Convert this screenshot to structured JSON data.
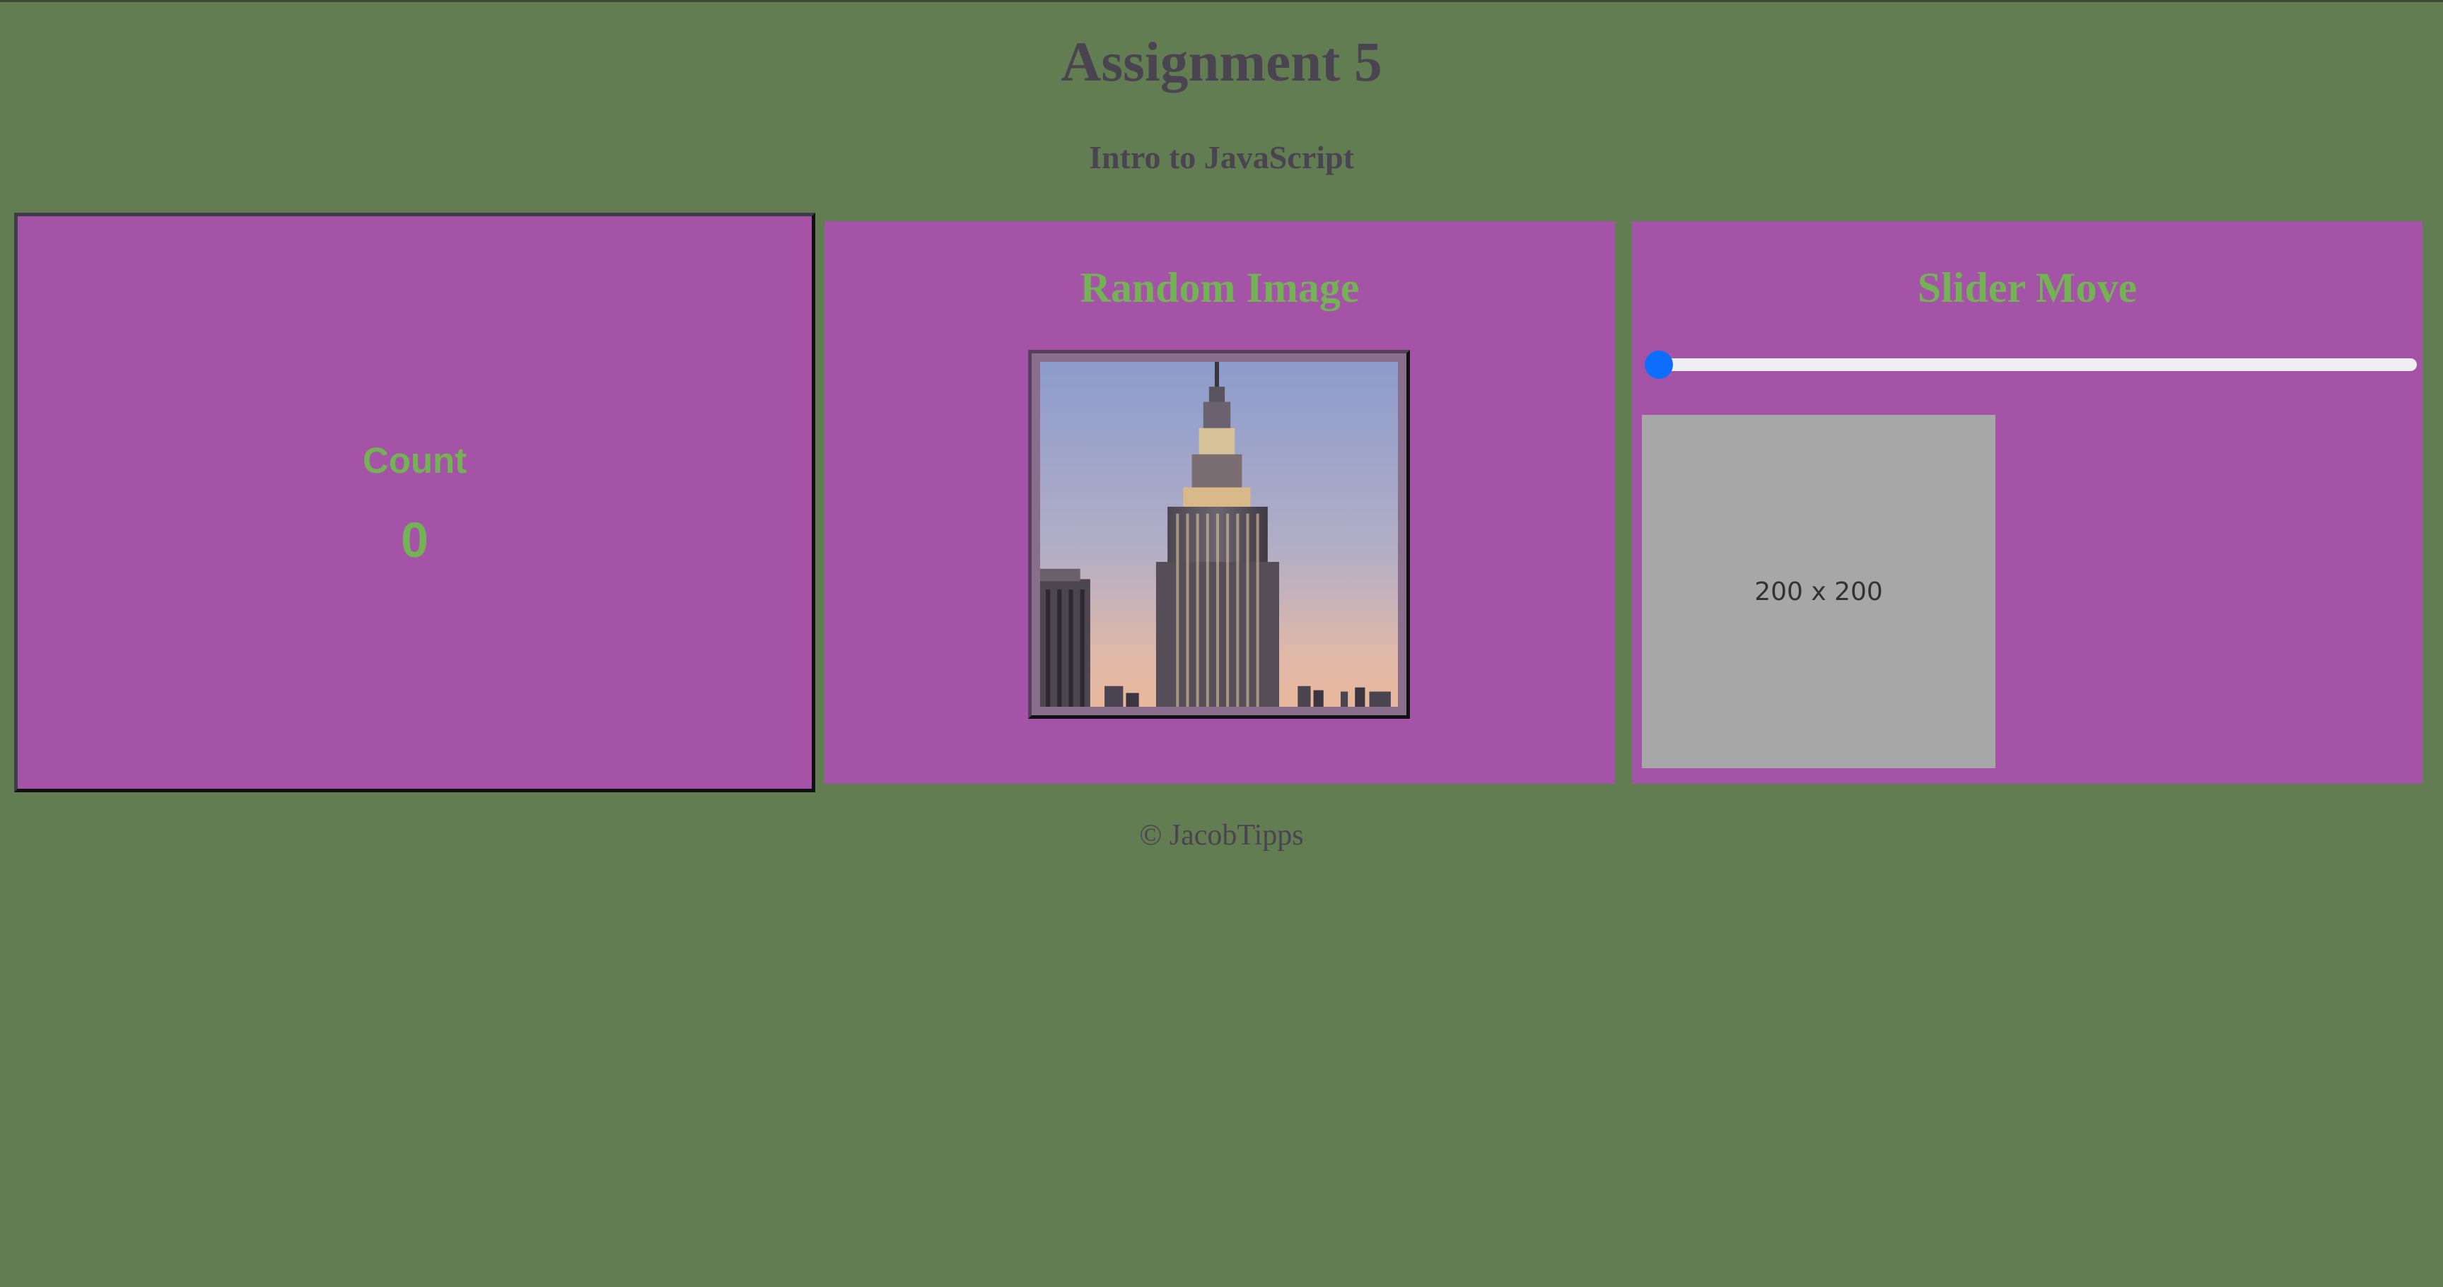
{
  "header": {
    "title": "Assignment 5",
    "subtitle": "Intro to JavaScript"
  },
  "count_panel": {
    "label": "Count",
    "value": "0"
  },
  "image_panel": {
    "heading": "Random Image",
    "image": "empire-state-building-photo"
  },
  "slider_panel": {
    "heading": "Slider Move",
    "slider_value": 0,
    "placeholder_text": "200 x 200"
  },
  "footer": {
    "text": "© JacobTipps"
  },
  "colors": {
    "background": "#627d52",
    "panel": "#a553a6",
    "heading_green": "#74b256",
    "title_text": "#4a4451",
    "slider_thumb": "#0d6efd",
    "placeholder": "#a7a7a7"
  }
}
